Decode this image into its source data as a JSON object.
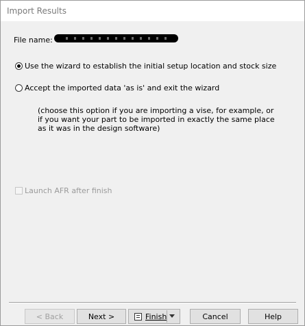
{
  "window": {
    "title": "Import Results"
  },
  "file": {
    "label": "File name:"
  },
  "options": {
    "wizard_label": "Use the wizard to establish the initial setup location and stock size",
    "wizard_selected": true,
    "accept_label": "Accept the imported data  'as is' and exit the wizard",
    "accept_selected": false,
    "note_lines": [
      "(choose this option if you are importing a vise, for example, or",
      "if you want your part to be imported in exactly the same place",
      "as it was in the design software)"
    ]
  },
  "launch": {
    "label": "Launch AFR after finish",
    "checked": false,
    "enabled": false
  },
  "buttons": {
    "back": "< Back",
    "next": "Next >",
    "finish": "Finish",
    "cancel": "Cancel",
    "help": "Help"
  },
  "icons": {
    "finish": "finish-list-icon",
    "dropdown": "chevron-down-icon"
  }
}
